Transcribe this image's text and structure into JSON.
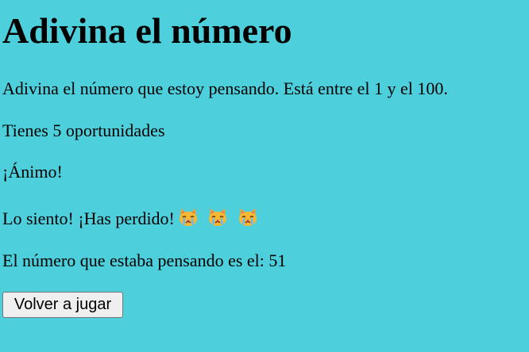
{
  "title": "Adivina el número",
  "intro": "Adivina el número que estoy pensando. Está entre el 1 y el 100.",
  "attempts_text": "Tienes 5 oportunidades",
  "encouragement": "¡Ánimo!",
  "result_text": "Lo siento! ¡Has perdido!",
  "result_icons": [
    "crying-cat-icon",
    "crying-cat-icon",
    "crying-cat-icon"
  ],
  "reveal_text": "El número que estaba pensando es el: 51",
  "replay_button": "Volver a jugar",
  "colors": {
    "background": "#4ecfdc",
    "text": "#000000",
    "button_bg": "#efefef",
    "button_border": "#767676"
  }
}
